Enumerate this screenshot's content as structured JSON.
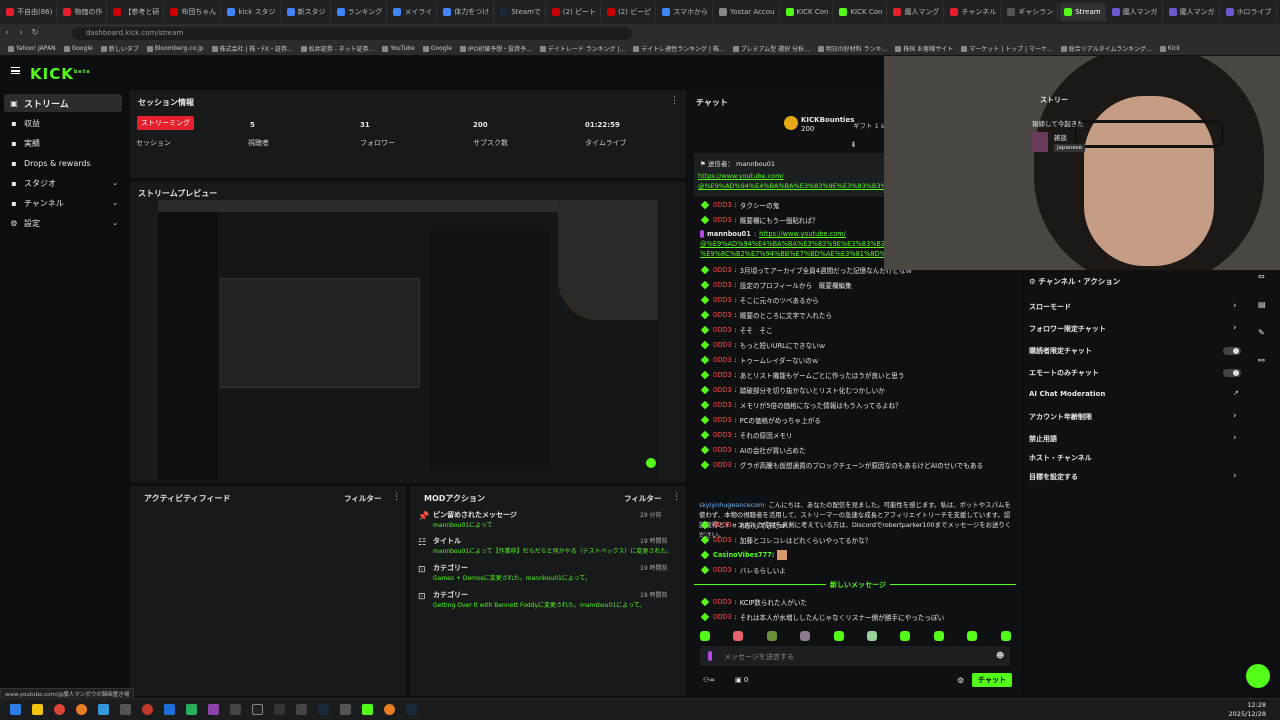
{
  "browser": {
    "tabs": [
      "不自由(86)",
      "物価の作",
      "【参考と研",
      "布団ちゃん",
      "kick スタジ",
      "新スタジ",
      "ランキング",
      "メイライ",
      "体力をつけ",
      "Steamで",
      "(2) ピート",
      "(2) ビーピ",
      "スマホから",
      "Yostar Accou",
      "KICK Con",
      "KICK Con",
      "魔人マング",
      "チャンネル",
      "ギャシラン",
      "Stream",
      "魔人マンガ",
      "魔人マンガ",
      "ホロライブ"
    ],
    "active_tab_index": 19,
    "url": "dashboard.kick.com/stream",
    "bookmarks": [
      "Yahoo! JAPAN",
      "Google",
      "新しいタブ",
      "Bloomberg.co.jp",
      "株式会社 | 株・FX・証券...",
      "松井証券 - ネット証券...",
      "YouTube",
      "Google",
      "IPO初値予想・投資予...",
      "デイトレード ランキング |...",
      "デイトレ適性ランキング | 株...",
      "プレミアム型 選択 分析...",
      "明日の好材料 ランキ...",
      "株探 お客様サイト",
      "マーケット | トップ | マーケ...",
      "総合リアルタイムランキング...",
      "Kick"
    ]
  },
  "header": {
    "logo": "KICK",
    "logo_sup": "beta"
  },
  "sidebar": {
    "items": [
      {
        "label": "ストリーム",
        "icon": "video-icon"
      },
      {
        "label": "収益",
        "icon": "money-icon"
      },
      {
        "label": "実績",
        "icon": "trophy-icon"
      },
      {
        "label": "Drops & rewards",
        "icon": "gift-icon"
      },
      {
        "label": "スタジオ",
        "icon": "studio-icon"
      },
      {
        "label": "チャンネル",
        "icon": "channel-icon"
      },
      {
        "label": "設定",
        "icon": "gear-icon"
      }
    ]
  },
  "session": {
    "title": "セッション情報",
    "live_badge": "ストリーミング",
    "stats": [
      {
        "value": "",
        "label": "セッション"
      },
      {
        "value": "5",
        "label": "視聴者"
      },
      {
        "value": "31",
        "label": "フォロワー"
      },
      {
        "value": "200",
        "label": "サブスク数"
      },
      {
        "value": "01:22:59",
        "label": "タイムライブ"
      }
    ]
  },
  "preview": {
    "title": "ストリームプレビュー"
  },
  "activity": {
    "title": "アクティビティフィード",
    "filter": "フィルター"
  },
  "mod": {
    "title": "MODアクション",
    "filter": "フィルター",
    "items": [
      {
        "title": "ピン留めされたメッセージ",
        "desc": "mannbou01によって",
        "time": "29 分前"
      },
      {
        "title": "タイトル",
        "desc": "mannbou01によって【作業枠】だらだらと何かやる（テストベックス）に変更された。",
        "time": "19 時間前"
      },
      {
        "title": "カテゴリー",
        "desc": "Games + Demosに変更された。mannbou01によって。",
        "time": "19 時間前"
      },
      {
        "title": "カテゴリー",
        "desc": "Getting Over It with Bennett Foddyに変更された。mannbou01によって。",
        "time": "19 時間前"
      }
    ]
  },
  "chat": {
    "title": "チャット",
    "bounty": {
      "name": "KICKBounties",
      "amount": "200",
      "gift_text": "ギフト 1 subs to take 2h"
    },
    "pinned": {
      "label": "送信者：",
      "user": "mannbou01",
      "link1": "https://www.youtube.com/",
      "link2": "@%E9%AD%94%E4%BA%BA%E3%83%9E%E3%83%B3%E3%83%9C%E3%82%..."
    },
    "messages": [
      {
        "user": "0DD3",
        "text": "タクシーの鬼"
      },
      {
        "user": "0DD3",
        "text": "概要欄にもう一個貼れば？"
      },
      {
        "user": "mannbou01",
        "text": "https://www.youtube.com/"
      },
      {
        "user": "",
        "text": "@%E9%AD%94%E4%BA%BA%E3%83%9E%E3%83%B3%E3%83%9C%E3%82%A6%E3%81%AE"
      },
      {
        "user": "",
        "text": "%E9%8C%B2%E7%94%BB%E7%BD%AE%E3%81%8D%E5%A0%B4"
      },
      {
        "user": "0DD3",
        "text": "3月頃ってアーカイブ全員4週間だった記憶なんだけどなｗ"
      },
      {
        "user": "0DD3",
        "text": "設定のプロフィールから　概要欄編集"
      },
      {
        "user": "0DD3",
        "text": "そこに元々のツベあるから"
      },
      {
        "user": "0DD3",
        "text": "概要のところに文字で入れたら"
      },
      {
        "user": "0DD3",
        "text": "そそ　そこ"
      },
      {
        "user": "0DD3",
        "text": "もっと短いURLにできないｗ"
      },
      {
        "user": "0DD3",
        "text": "トゥームレイダーないのｗ"
      },
      {
        "user": "0DD3",
        "text": "あとリスト機能もゲームごとに作ったほうが良いと思う"
      },
      {
        "user": "0DD3",
        "text": "踏破部分を切り抜かないとリスト化むつかしいか"
      },
      {
        "user": "0DD3",
        "text": "メモリが5倍の価格になった情報はもう入ってるよね？"
      },
      {
        "user": "0DD3",
        "text": "PCの価格がめっちゃ上がる"
      },
      {
        "user": "0DD3",
        "text": "それの原因メモリ"
      },
      {
        "user": "0DD3",
        "text": "AIの会社が買い占めた"
      },
      {
        "user": "0DD3",
        "text": "グラボ高騰も仮想通貨のブロックチェーンが原因なのもあるけどAIのせいでもある"
      }
    ],
    "spam": {
      "user": "skylynhugeancecom:",
      "text": "こんにちは、あなたの配信を見ました。可能性を感じます。私は、ボットやスパムを使わず、本物の視聴者を活用して、ストリーマーの急速な成長とアフィリエイトリーチを支援しています。認証取得とチャンネルの成長を真剣に考えている方は、Discordでrobertparker100までメッセージをお送りください。"
    },
    "messages2": [
      {
        "user": "0DD3",
        "text": "和訳してきたｗ"
      },
      {
        "user": "0DD3",
        "text": "加藤とコレコレはどれくらいやってるかな？"
      },
      {
        "user": "CasinoVibes777:",
        "text": ""
      },
      {
        "user": "0DD3",
        "text": "バレるらしいよ"
      }
    ],
    "new_messages": "新しいメッセージ",
    "messages3": [
      {
        "user": "0DD3",
        "text": "KCIP数られた人がいた"
      },
      {
        "user": "0DD3",
        "text": "それは本人が水増ししたんじゃなくリスナー側が勝手にやったっぽい"
      }
    ],
    "input_placeholder": "メッセージを送信する",
    "send_button": "チャット",
    "viewer_count": "0"
  },
  "right_panel": {
    "title": "ストリー",
    "stream_title": "報締して今起きた",
    "category": "雑談",
    "language": "Japanese",
    "actions_title": "チャンネル・アクション",
    "actions": [
      {
        "label": "スローモード",
        "type": "arrow"
      },
      {
        "label": "フォロワー限定チャット",
        "type": "arrow"
      },
      {
        "label": "購読者限定チャット",
        "type": "toggle"
      },
      {
        "label": "エモートのみチャット",
        "type": "toggle"
      },
      {
        "label": "AI Chat Moderation",
        "type": "link"
      },
      {
        "label": "アカウント年齢制限",
        "type": "arrow"
      },
      {
        "label": "禁止用語",
        "type": "arrow"
      },
      {
        "label": "ホスト・チャンネル",
        "type": "none"
      },
      {
        "label": "目標を設定する",
        "type": "arrow"
      }
    ]
  },
  "status_url": "www.youtube.com/@魔人マンボウの録画置き場",
  "taskbar": {
    "time": "12:28",
    "date": "2025/12/28"
  },
  "colors": {
    "kick_green": "#53fc18",
    "live_red": "#e5202c",
    "bg": "#0b0e0f",
    "panel": "#17191b",
    "chat_user": "#ff4d4d"
  }
}
